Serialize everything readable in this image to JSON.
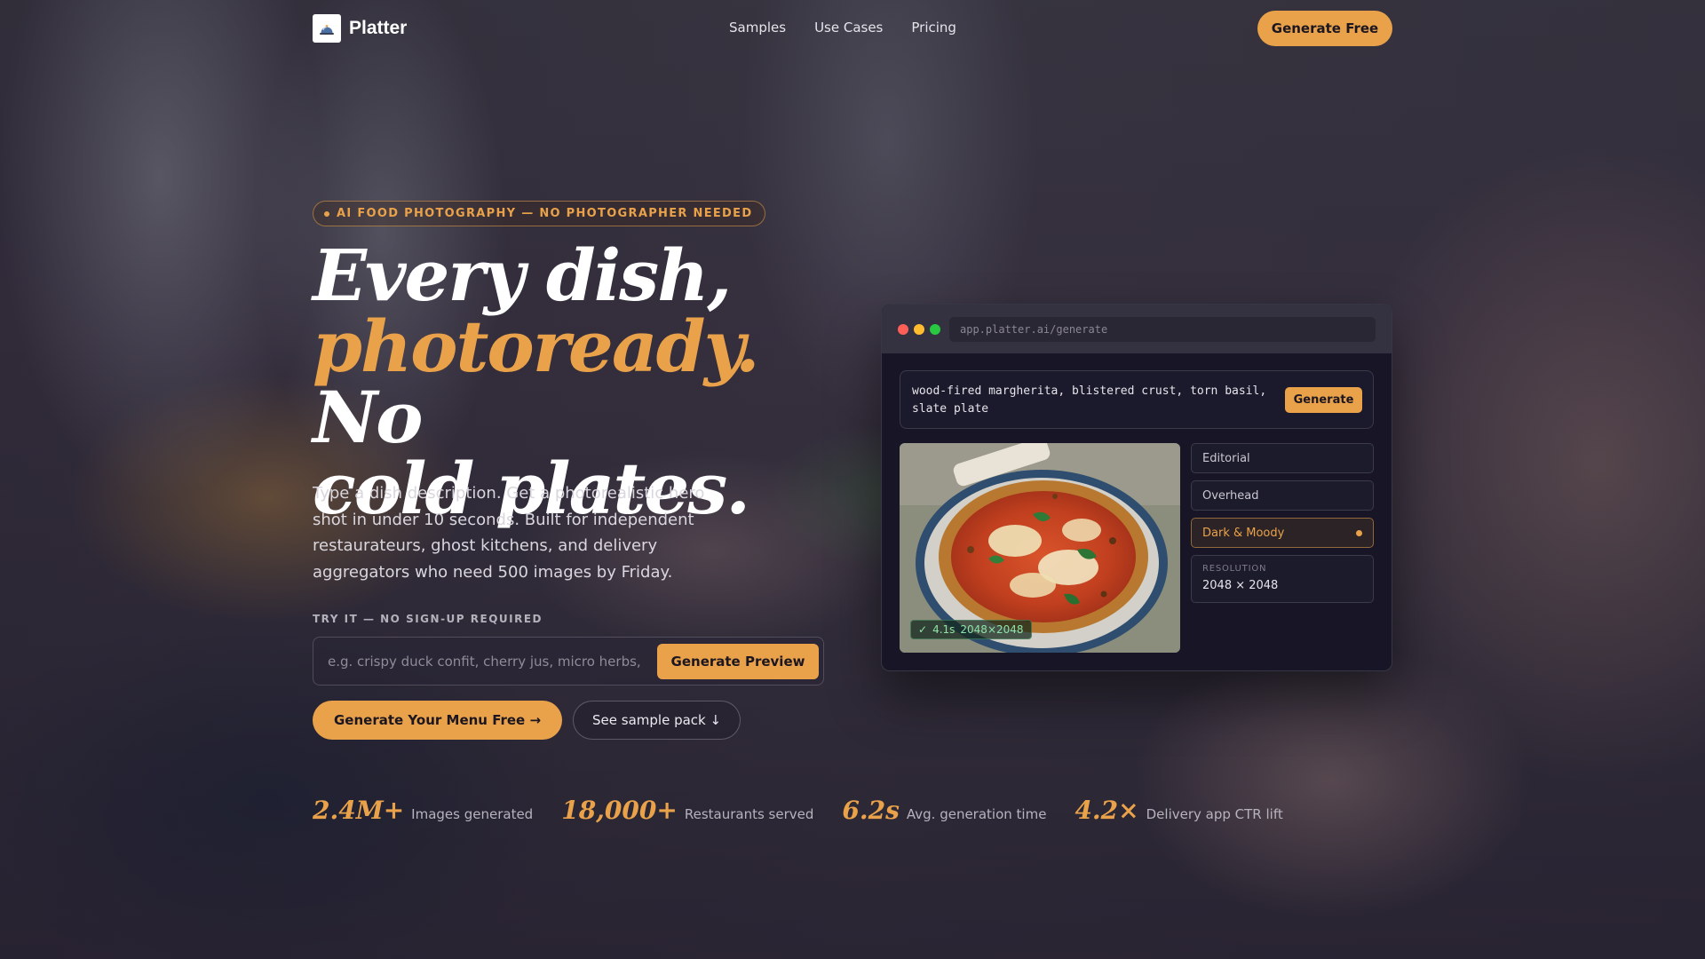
{
  "brand": {
    "name": "Platter",
    "accent_color": "#e9a24a",
    "logo_icon": "cloche-icon"
  },
  "nav": {
    "links": [
      "Samples",
      "Use Cases",
      "Pricing"
    ],
    "cta_label": "Generate Free"
  },
  "hero": {
    "badge": "AI FOOD PHOTOGRAPHY — NO PHOTOGRAPHER NEEDED",
    "headline": {
      "line1": "Every dish,",
      "accent": "photoready.",
      "line2_rest": " No",
      "line3": "cold plates."
    },
    "subcopy": "Type a dish description. Get a photorealistic hero shot in under 10 seconds. Built for independent restaurateurs, ghost kitchens, and delivery aggregators who need 500 images by Friday.",
    "try_label": "TRY IT — NO SIGN-UP REQUIRED",
    "try_placeholder": "e.g. crispy duck confit, cherry jus, micro herbs, slate",
    "try_button": "Generate Preview",
    "cta_primary": "Generate Your Menu Free →",
    "cta_secondary": "See sample pack ↓"
  },
  "stats": [
    {
      "value": "2.4M+",
      "label": "Images generated"
    },
    {
      "value": "18,000+",
      "label": "Restaurants served"
    },
    {
      "value": "6.2s",
      "label": "Avg. generation time"
    },
    {
      "value": "4.2×",
      "label": "Delivery app CTR lift"
    }
  ],
  "app": {
    "url": "app.platter.ai/generate",
    "prompt": "wood-fired margherita, blistered crust, torn basil, slate plate",
    "generate_label": "Generate",
    "preview_meta": {
      "check": "✓",
      "time": "4.1s",
      "size": "2048×2048"
    },
    "styles": [
      {
        "label": "Editorial",
        "selected": false
      },
      {
        "label": "Overhead",
        "selected": false
      },
      {
        "label": "Dark & Moody",
        "selected": true
      }
    ],
    "resolution_label": "RESOLUTION",
    "resolution_value": "2048 × 2048",
    "traffic_light_colors": [
      "#ff5f57",
      "#febc2e",
      "#28c840"
    ]
  }
}
